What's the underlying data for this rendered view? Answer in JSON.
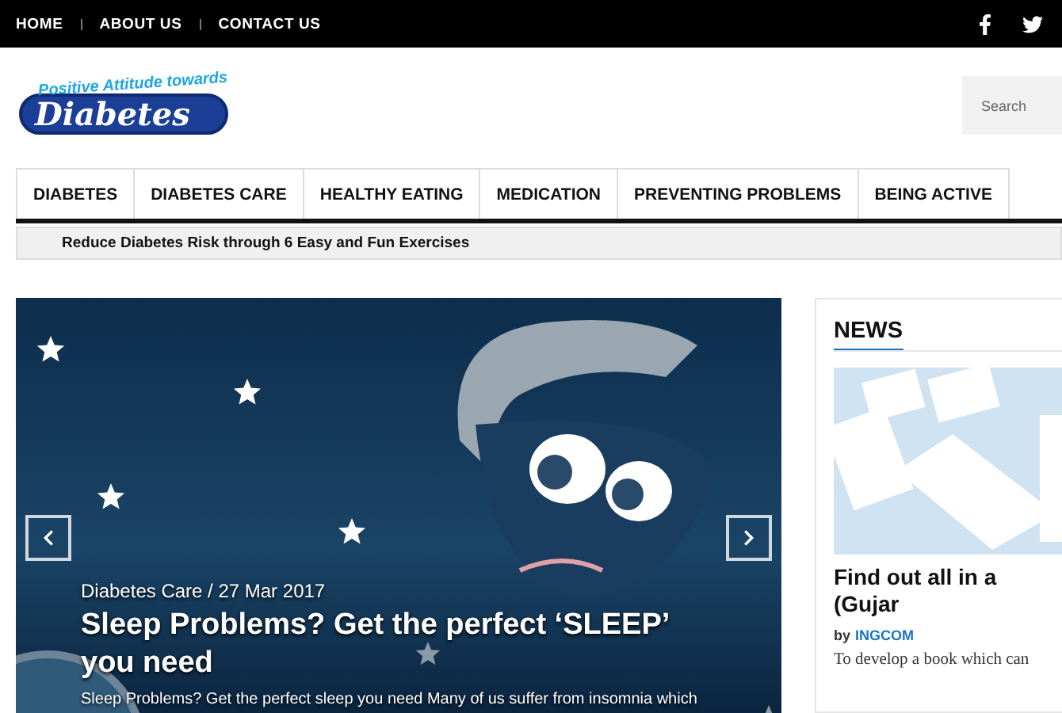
{
  "top_bar": {
    "links": [
      {
        "label": "HOME"
      },
      {
        "label": "ABOUT US"
      },
      {
        "label": "CONTACT US"
      }
    ],
    "social": [
      {
        "kind": "facebook"
      },
      {
        "kind": "twitter"
      }
    ]
  },
  "header": {
    "logo": {
      "tagline": "Positive Attitude towards",
      "name": "Diabetes"
    },
    "search": {
      "placeholder": "Search"
    }
  },
  "nav": {
    "items": [
      {
        "label": "DIABETES"
      },
      {
        "label": "DIABETES CARE"
      },
      {
        "label": "HEALTHY EATING"
      },
      {
        "label": "MEDICATION"
      },
      {
        "label": "PREVENTING PROBLEMS"
      },
      {
        "label": "BEING ACTIVE"
      }
    ]
  },
  "ticker": {
    "text": "Reduce Diabetes Risk through 6 Easy and Fun Exercises"
  },
  "slider": {
    "meta": "Diabetes Care / 27 Mar 2017",
    "title": "Sleep Problems? Get the perfect ‘SLEEP’ you need",
    "excerpt": "Sleep Problems? Get the perfect sleep you need Many of us suffer from insomnia which"
  },
  "sidebar": {
    "heading": "NEWS",
    "post": {
      "title": "Find out all in a (Gujar",
      "by": "by",
      "author": "INGCOM",
      "excerpt": "To develop a book which can"
    }
  }
}
